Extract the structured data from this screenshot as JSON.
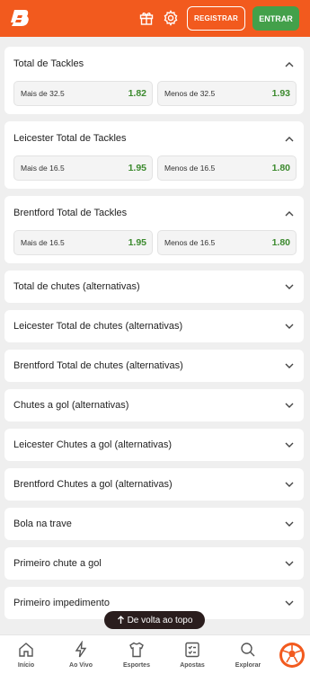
{
  "header": {
    "register_label": "REGISTRAR",
    "login_label": "ENTRAR",
    "brand_color": "#f25a1e",
    "login_color": "#43a04a"
  },
  "markets": [
    {
      "title": "Total de Tackles",
      "expanded": true,
      "odds": [
        {
          "label": "Mais de 32.5",
          "value": "1.82"
        },
        {
          "label": "Menos de 32.5",
          "value": "1.93"
        }
      ]
    },
    {
      "title": "Leicester Total de Tackles",
      "expanded": true,
      "odds": [
        {
          "label": "Mais de 16.5",
          "value": "1.95"
        },
        {
          "label": "Menos de 16.5",
          "value": "1.80"
        }
      ]
    },
    {
      "title": "Brentford Total de Tackles",
      "expanded": true,
      "odds": [
        {
          "label": "Mais de 16.5",
          "value": "1.95"
        },
        {
          "label": "Menos de 16.5",
          "value": "1.80"
        }
      ]
    },
    {
      "title": "Total de chutes (alternativas)",
      "expanded": false
    },
    {
      "title": "Leicester Total de chutes (alternativas)",
      "expanded": false
    },
    {
      "title": "Brentford Total de chutes (alternativas)",
      "expanded": false
    },
    {
      "title": "Chutes a gol (alternativas)",
      "expanded": false
    },
    {
      "title": "Leicester Chutes a gol (alternativas)",
      "expanded": false
    },
    {
      "title": "Brentford Chutes a gol (alternativas)",
      "expanded": false
    },
    {
      "title": "Bola na trave",
      "expanded": false
    },
    {
      "title": "Primeiro chute a gol",
      "expanded": false
    },
    {
      "title": "Primeiro impedimento",
      "expanded": false
    }
  ],
  "back_to_top": "De volta ao topo",
  "bottom_nav": [
    {
      "label": "Início",
      "icon": "home-icon"
    },
    {
      "label": "Ao Vivo",
      "icon": "lightning-icon"
    },
    {
      "label": "Esportes",
      "icon": "shirt-icon"
    },
    {
      "label": "Apostas",
      "icon": "betslip-icon"
    },
    {
      "label": "Explorar",
      "icon": "search-icon"
    }
  ],
  "odd_color": "#3c8a2e"
}
